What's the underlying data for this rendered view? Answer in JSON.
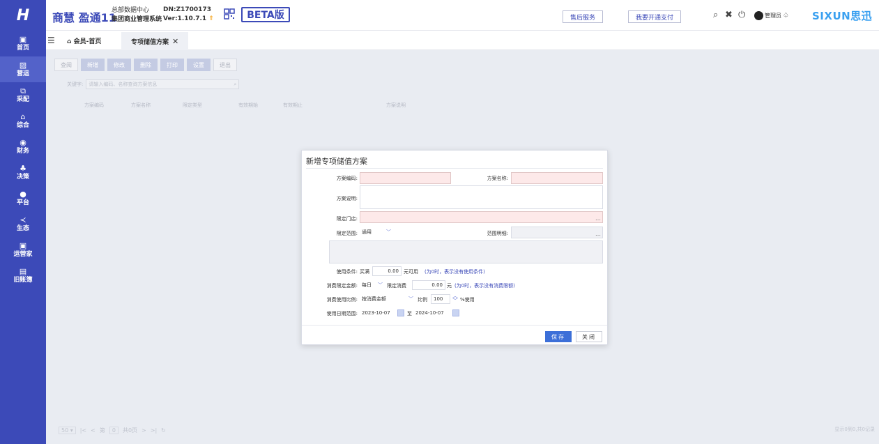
{
  "sidebar": {
    "logo": "H",
    "items": [
      {
        "icon": "home-icon",
        "glyph": "▣",
        "label": "首页"
      },
      {
        "icon": "operations-icon",
        "glyph": "▨",
        "label": "营运"
      },
      {
        "icon": "purchase-icon",
        "glyph": "⧉",
        "label": "采配"
      },
      {
        "icon": "composite-icon",
        "glyph": "⌂",
        "label": "综合"
      },
      {
        "icon": "finance-icon",
        "glyph": "◉",
        "label": "财务"
      },
      {
        "icon": "decision-icon",
        "glyph": "♣",
        "label": "决策"
      },
      {
        "icon": "platform-icon",
        "glyph": "●",
        "label": "平台"
      },
      {
        "icon": "ecology-icon",
        "glyph": "≺",
        "label": "生态"
      },
      {
        "icon": "operator-icon",
        "glyph": "▣",
        "label": "运营家"
      },
      {
        "icon": "old-account-icon",
        "glyph": "▤",
        "label": "旧账簿"
      }
    ]
  },
  "header": {
    "brand": "商慧 盈通11",
    "center_line1": "总部数据中心",
    "center_line2": "集团商业管理系统",
    "dn": "DN:Z1700173",
    "version": "Ver:1.10.7.1",
    "beta": "BETA版",
    "after_sales": "售后服务",
    "open_pay": "我要开通支付",
    "admin": "管理员",
    "sixun": "SIXUN思迅"
  },
  "tabs": {
    "home": "会员-首页",
    "active": "专项储值方案"
  },
  "toolbar": {
    "buttons": [
      "查阅",
      "新增",
      "修改",
      "删除",
      "打印",
      "设置",
      "退出"
    ]
  },
  "search": {
    "label": "关键字:",
    "placeholder": "请输入编码、名称查询方案信息"
  },
  "grid": {
    "columns": [
      "方案编码",
      "方案名称",
      "限定类型",
      "有效期始",
      "有效期止",
      "方案说明"
    ]
  },
  "pager": {
    "size": "50",
    "page_prefix": "第",
    "page": "0",
    "total": "共0页",
    "info": "显示0到0,共0记录"
  },
  "dialog": {
    "title": "新增专项储值方案",
    "code_label": "方案编码:",
    "name_label": "方案名称:",
    "desc_label": "方案说明:",
    "store_label": "限定门店:",
    "scope_label": "限定范围:",
    "scope_value": "通用",
    "scope_detail_label": "范围明细:",
    "use_cond_label": "使用条件:",
    "use_cond_prefix": "买满",
    "use_cond_amount": "0.00",
    "use_cond_suffix": "元可用",
    "use_cond_hint": "(为0时，表示没有使用条件)",
    "limit_label": "消费限定金额:",
    "limit_period": "每日",
    "limit_text": "限定消费",
    "limit_amount": "0.00",
    "limit_suffix": "元",
    "limit_hint": "(为0时，表示没有消费限额)",
    "ratio_label": "消费使用比例:",
    "ratio_mode": "按消费金额",
    "ratio_text": "比例",
    "ratio_value": "100",
    "ratio_suffix": "%使用",
    "date_label": "使用日期范围:",
    "date_from": "2023-10-07",
    "date_to_word": "至",
    "date_to": "2024-10-07",
    "save": "保存",
    "close": "关闭"
  },
  "colors": {
    "brand_blue": "#3c4ab8",
    "required_field": "#fde9e9",
    "primary_button": "#3c6fd8"
  }
}
